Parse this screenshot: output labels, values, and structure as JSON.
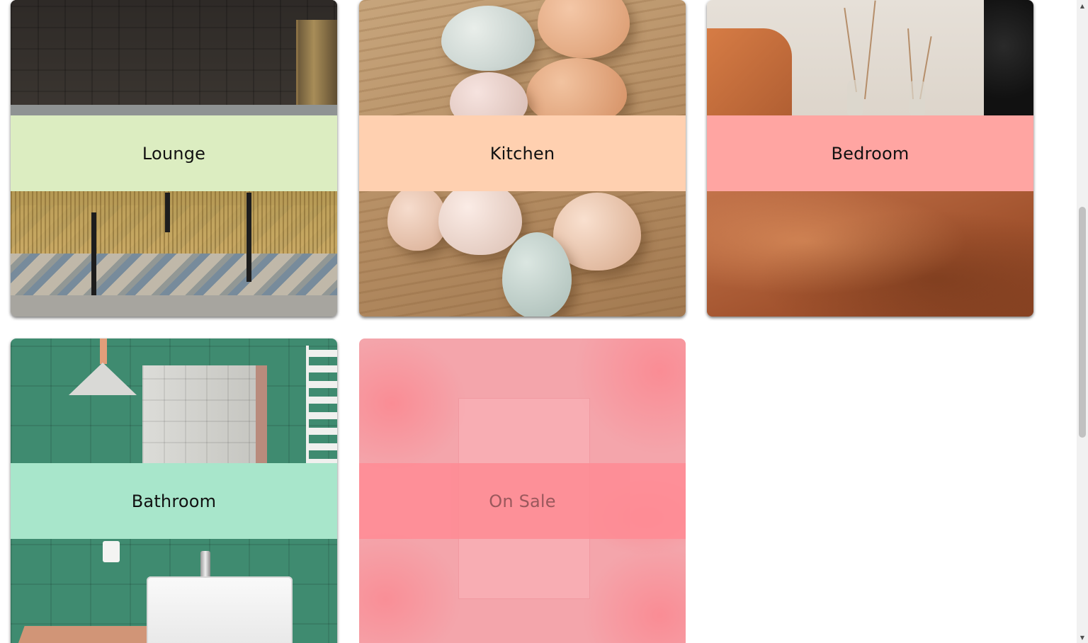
{
  "categories": [
    {
      "id": "lounge",
      "label": "Lounge",
      "band_color": "#dcedc1"
    },
    {
      "id": "kitchen",
      "label": "Kitchen",
      "band_color": "#ffd0b0"
    },
    {
      "id": "bedroom",
      "label": "Bedroom",
      "band_color": "#ffa5a2"
    },
    {
      "id": "bathroom",
      "label": "Bathroom",
      "band_color": "#a8e6cb"
    },
    {
      "id": "on-sale",
      "label": "On Sale",
      "band_color": "#ff8b94"
    }
  ],
  "scrollbar": {
    "up_icon": "triangle-up-icon",
    "down_icon": "triangle-down-icon"
  }
}
